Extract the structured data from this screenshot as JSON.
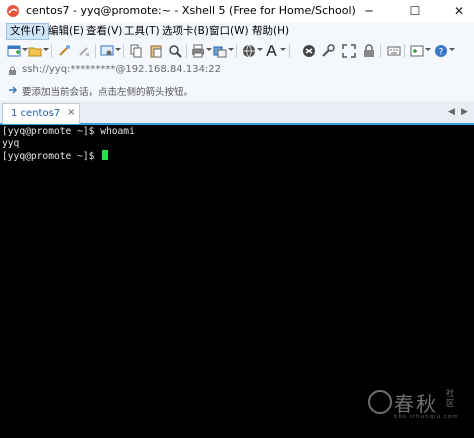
{
  "window": {
    "title": "centos7 - yyq@promote:~ - Xshell 5 (Free for Home/School)",
    "controls": {
      "minimize": "─",
      "maximize": "☐",
      "close": "✕"
    }
  },
  "menu": {
    "items": [
      "文件(F)",
      "编辑(E)",
      "查看(V)",
      "工具(T)",
      "选项卡(B)",
      "窗口(W)",
      "帮助(H)"
    ]
  },
  "toolbar": {
    "icons": [
      "new-session-icon",
      "open-folder-icon",
      "reconnect-icon",
      "disconnect-icon",
      "properties-icon",
      "copy-icon",
      "paste-icon",
      "find-icon",
      "print-icon",
      "transfer-icon",
      "globe-icon",
      "font-icon",
      "xftp-icon",
      "tools-icon",
      "fullscreen-icon",
      "lock-icon",
      "keyboard-icon",
      "script-icon",
      "help-icon"
    ]
  },
  "address": {
    "value": "ssh://yyq:*********@192.168.84.134:22"
  },
  "hint": {
    "text": "要添加当前会话，点击左侧的箭头按钮。"
  },
  "tabs": [
    {
      "number": "1",
      "label": "centos7",
      "close": "×",
      "active": true
    }
  ],
  "tab_nav": {
    "prev": "◀",
    "next": "▶"
  },
  "terminal": {
    "lines": [
      "[yyq@promote ~]$ whoami",
      "yyq",
      "[yyq@promote ~]$ "
    ],
    "cursor_color": "#27e046",
    "background": "#000000"
  },
  "watermark": {
    "main": "春秋",
    "side": "社区",
    "url": "bbs.ichunqiu.com"
  },
  "colors": {
    "accent": "#3aa0e4",
    "tab_text": "#1f5fa8"
  }
}
